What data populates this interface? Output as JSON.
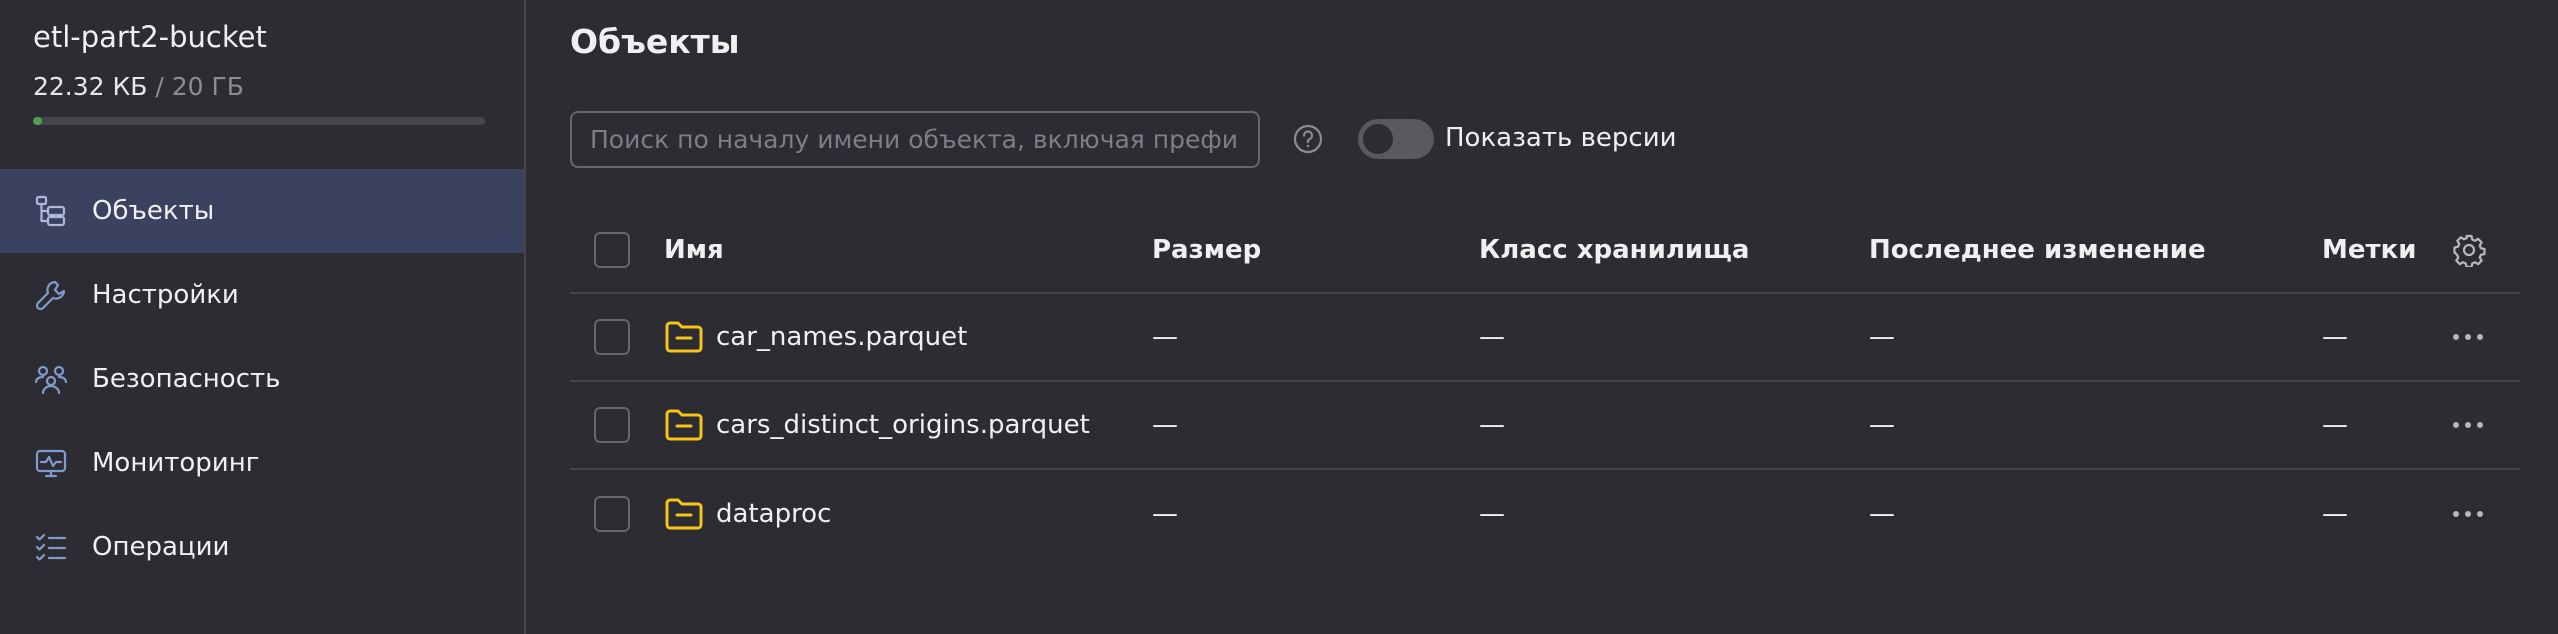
{
  "sidebar": {
    "bucket_name": "etl-part2-bucket",
    "usage": {
      "used": "22.32 КБ",
      "separator": " / ",
      "total": "20 ГБ",
      "fraction": 0.02
    },
    "items": [
      {
        "label": "Объекты",
        "icon": "objects-icon",
        "active": true
      },
      {
        "label": "Настройки",
        "icon": "wrench-icon",
        "active": false
      },
      {
        "label": "Безопасность",
        "icon": "users-icon",
        "active": false
      },
      {
        "label": "Мониторинг",
        "icon": "monitor-icon",
        "active": false
      },
      {
        "label": "Операции",
        "icon": "list-check-icon",
        "active": false
      }
    ]
  },
  "main": {
    "title": "Объекты",
    "search": {
      "placeholder": "Поиск по началу имени объекта, включая префикс",
      "value": ""
    },
    "show_versions_label": "Показать версии",
    "show_versions": false,
    "table": {
      "columns": {
        "name": "Имя",
        "size": "Размер",
        "class": "Класс хранилища",
        "modified": "Последнее изменение",
        "tags": "Метки"
      },
      "rows": [
        {
          "name": "car_names.parquet",
          "size": "—",
          "class": "—",
          "modified": "—",
          "tags": "—",
          "type": "folder"
        },
        {
          "name": "cars_distinct_origins.parquet",
          "size": "—",
          "class": "—",
          "modified": "—",
          "tags": "—",
          "type": "folder"
        },
        {
          "name": "dataproc",
          "size": "—",
          "class": "—",
          "modified": "—",
          "tags": "—",
          "type": "folder"
        }
      ]
    }
  },
  "colors": {
    "background": "#2d2c33",
    "active_nav": "#3b4260",
    "folder": "#f5c518",
    "usage_bar": "#4f9f4f"
  }
}
